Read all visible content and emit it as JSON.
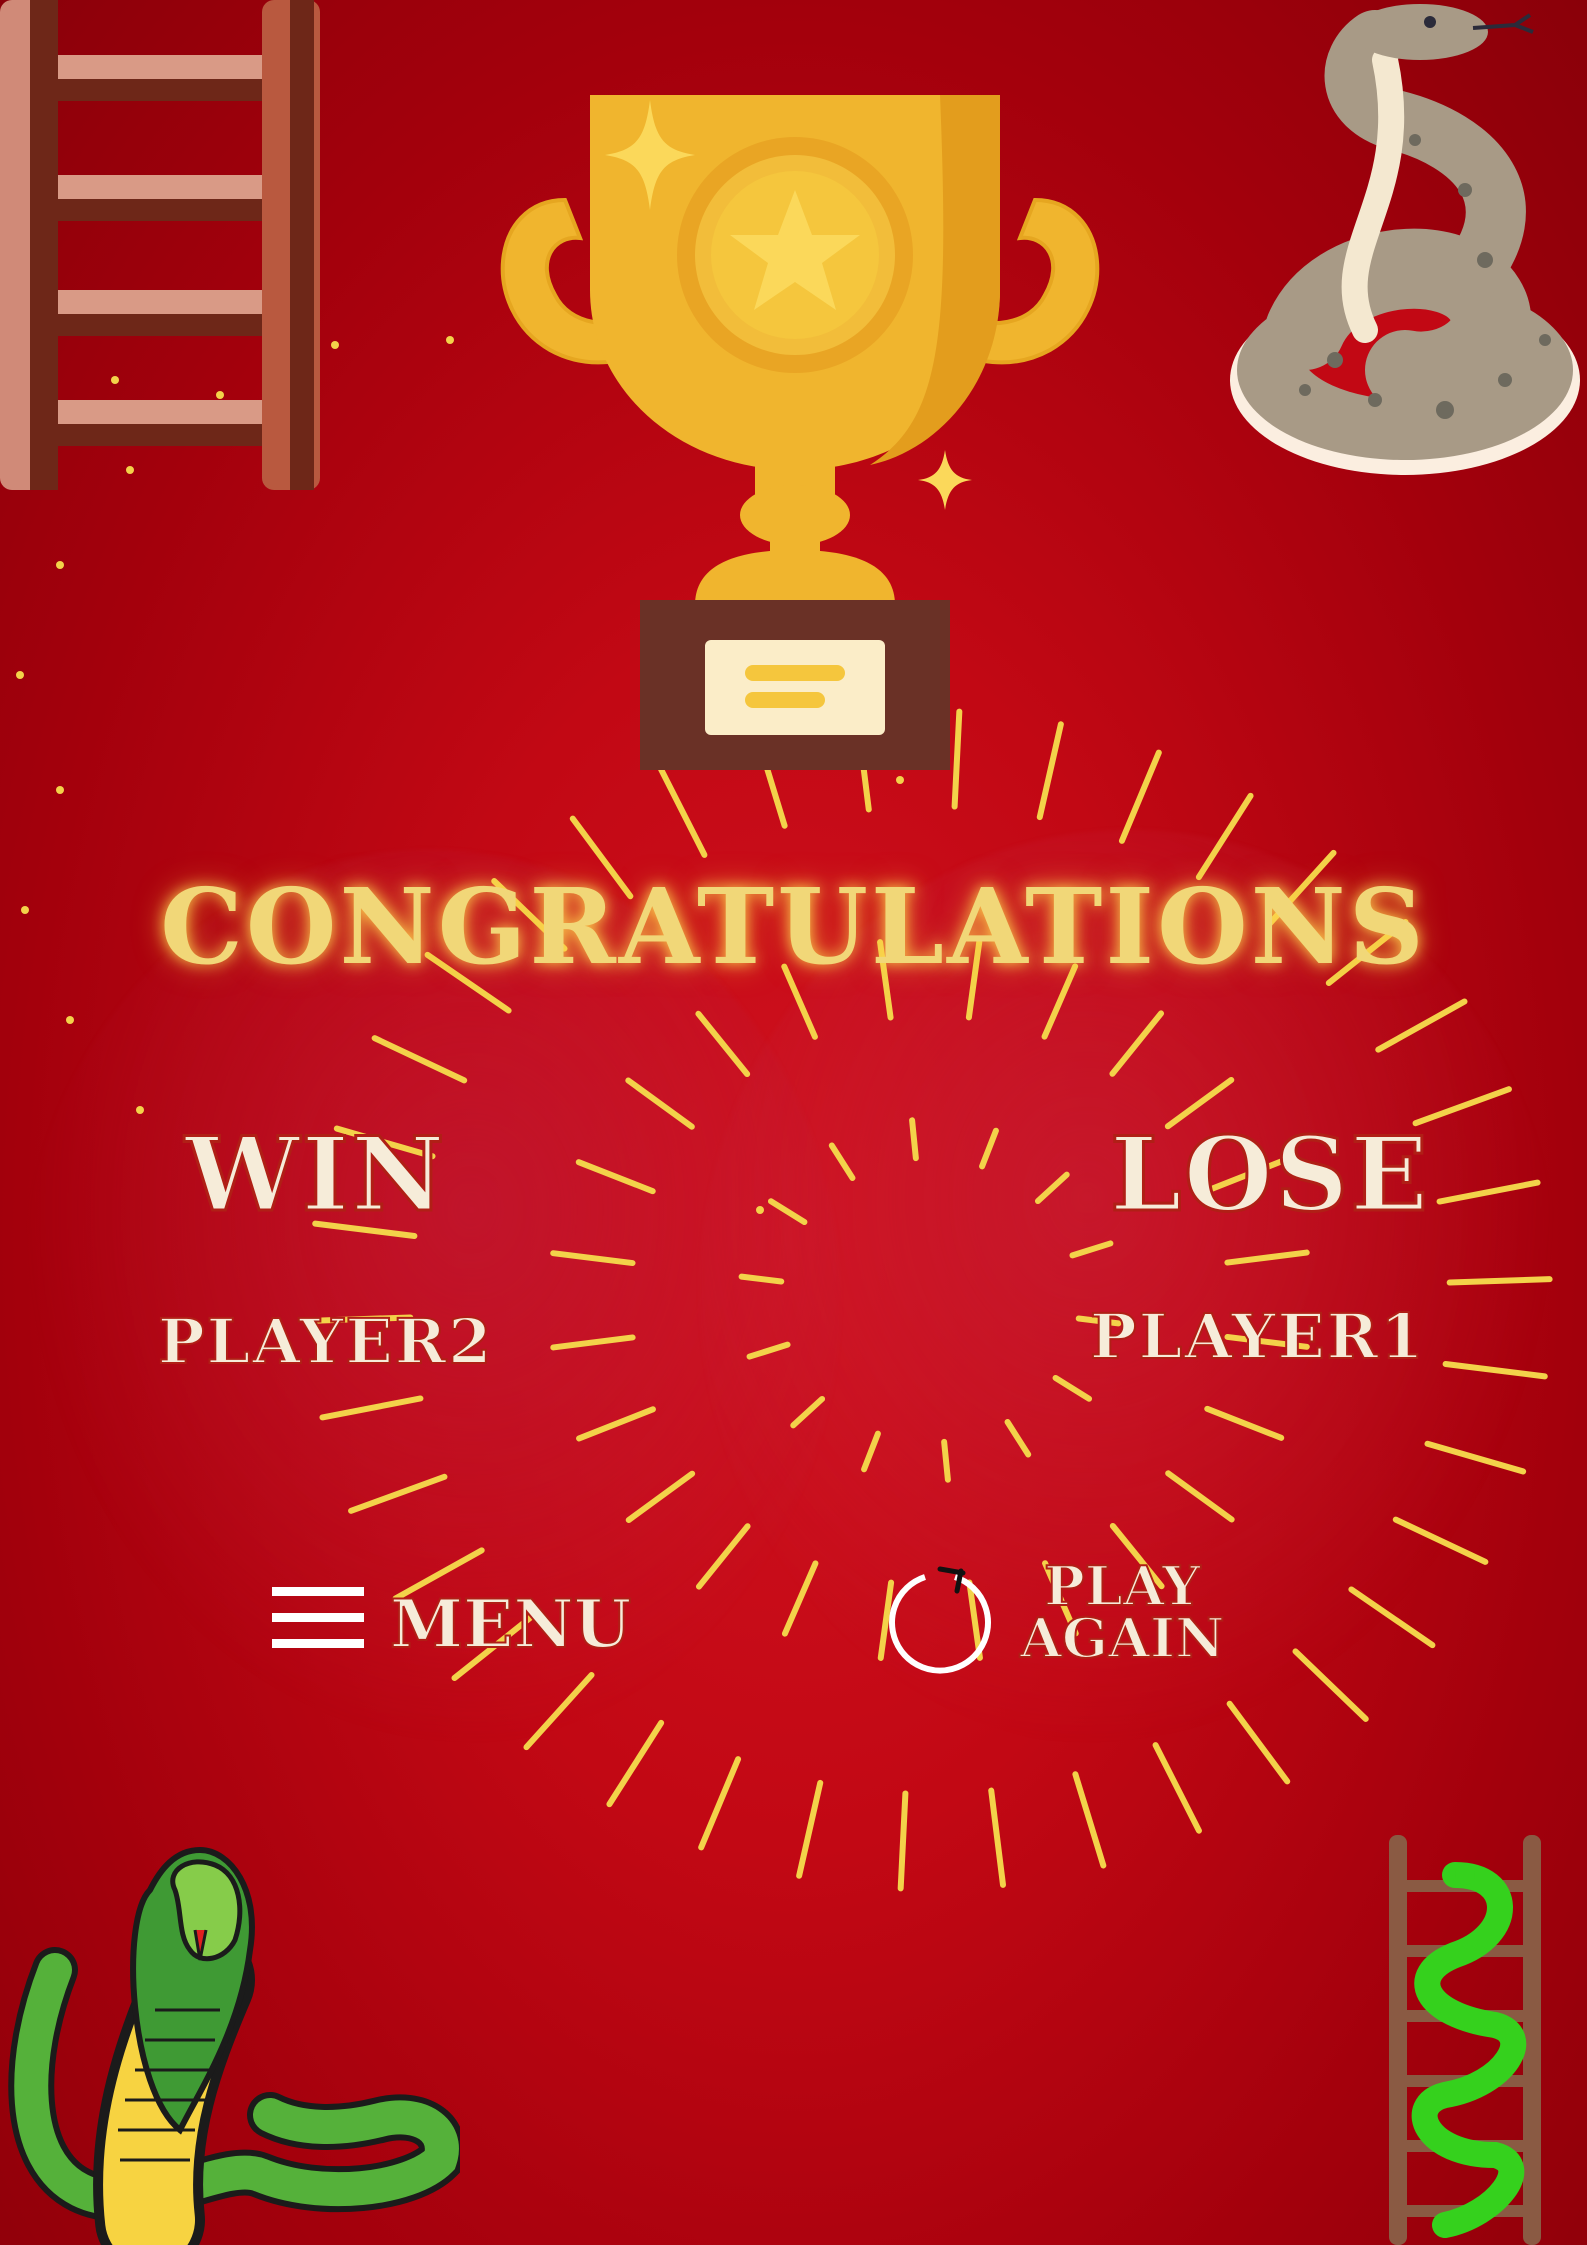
{
  "screen": {
    "heading": "CONGRATULATIONS",
    "winner": {
      "title": "WIN",
      "player": "PLAYER2"
    },
    "loser": {
      "title": "LOSE",
      "player": "PLAYER1"
    }
  },
  "buttons": {
    "menu_label": "MENU",
    "play_again_line1": "PLAY",
    "play_again_line2": "AGAIN"
  },
  "icons": {
    "menu": "hamburger-icon",
    "play_again": "restart-icon",
    "trophy": "trophy-icon"
  },
  "colors": {
    "background": "#c20814",
    "heading": "#f1d778",
    "label_fill": "#f6ecd9",
    "label_outline": "#b01f16",
    "trophy_gold": "#f0b52e",
    "rays": "#f3d24a"
  }
}
